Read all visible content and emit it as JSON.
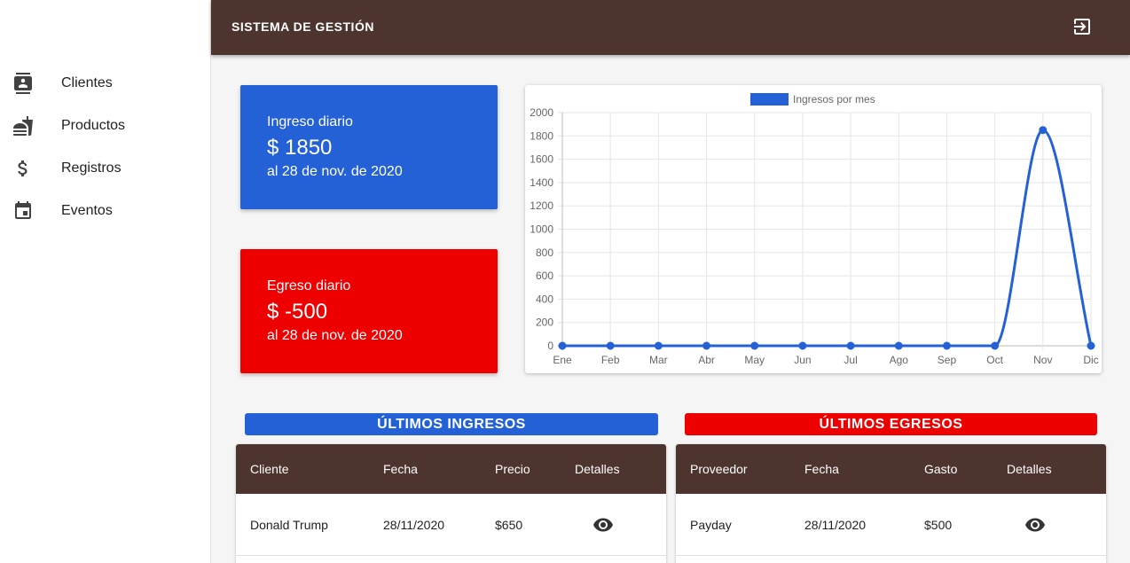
{
  "sidebar": {
    "items": [
      {
        "label": "Clientes",
        "icon": "contacts-icon"
      },
      {
        "label": "Productos",
        "icon": "fastfood-icon"
      },
      {
        "label": "Registros",
        "icon": "dollar-icon"
      },
      {
        "label": "Eventos",
        "icon": "calendar-icon"
      }
    ]
  },
  "header": {
    "title": "SISTEMA DE GESTIÓN",
    "logout_icon": "logout-icon"
  },
  "cards": {
    "ingreso": {
      "title": "Ingreso diario",
      "value": "$ 1850",
      "date": "al 28 de nov. de 2020",
      "color": "#2461d6"
    },
    "egreso": {
      "title": "Egreso diario",
      "value": "$ -500",
      "date": "al 28 de nov. de 2020",
      "color": "#ee0000"
    }
  },
  "chart_data": {
    "type": "line",
    "categories": [
      "Ene",
      "Feb",
      "Mar",
      "Abr",
      "May",
      "Jun",
      "Jul",
      "Ago",
      "Sep",
      "Oct",
      "Nov",
      "Dic"
    ],
    "series": [
      {
        "name": "Ingresos por mes",
        "values": [
          0,
          0,
          0,
          0,
          0,
          0,
          0,
          0,
          0,
          0,
          1850,
          0
        ],
        "color": "#2461d6"
      }
    ],
    "yticks": [
      0,
      200,
      400,
      600,
      800,
      1000,
      1200,
      1400,
      1600,
      1800,
      2000
    ],
    "ylim": [
      0,
      2000
    ],
    "grid": true,
    "legend": "top"
  },
  "ingresos": {
    "banner": "ÚLTIMOS INGRESOS",
    "headers": [
      "Cliente",
      "Fecha",
      "Precio",
      "Detalles"
    ],
    "rows": [
      {
        "cliente": "Donald Trump",
        "fecha": "28/11/2020",
        "precio": "$650"
      }
    ]
  },
  "egresos": {
    "banner": "ÚLTIMOS EGRESOS",
    "headers": [
      "Proveedor",
      "Fecha",
      "Gasto",
      "Detalles"
    ],
    "rows": [
      {
        "proveedor": "Payday",
        "fecha": "28/11/2020",
        "gasto": "$500"
      }
    ]
  },
  "colors": {
    "header": "#4e342e",
    "primary": "#2461d6",
    "danger": "#ee0000"
  }
}
